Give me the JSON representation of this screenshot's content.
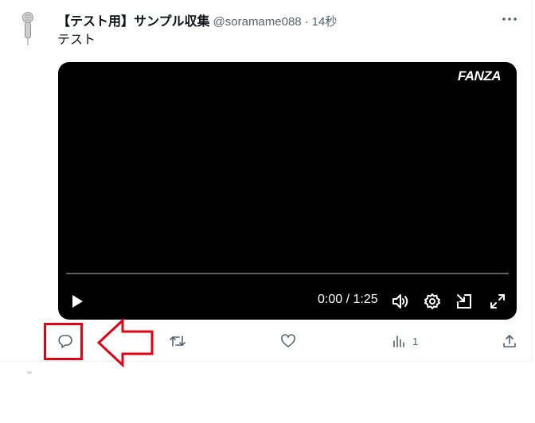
{
  "tweet": {
    "display_name": "【テスト用】サンプル収集",
    "handle": "@soramame088",
    "separator": "·",
    "time": "14秒",
    "text": "テスト"
  },
  "video": {
    "watermark": "FANZA",
    "current_time": "0:00",
    "duration": "1:25",
    "time_separator": "/",
    "progress": 0
  },
  "actions": {
    "reply": {
      "icon": "reply-icon",
      "count": ""
    },
    "retweet": {
      "icon": "retweet-icon",
      "count": ""
    },
    "like": {
      "icon": "heart-icon",
      "count": ""
    },
    "views": {
      "icon": "views-icon",
      "count": "1"
    },
    "share": {
      "icon": "share-icon",
      "count": ""
    }
  },
  "annotation": {
    "box_color": "#e60012",
    "arrow_direction": "left"
  },
  "colors": {
    "text_primary": "#0f1419",
    "text_secondary": "#536471",
    "video_bg": "#000000"
  }
}
